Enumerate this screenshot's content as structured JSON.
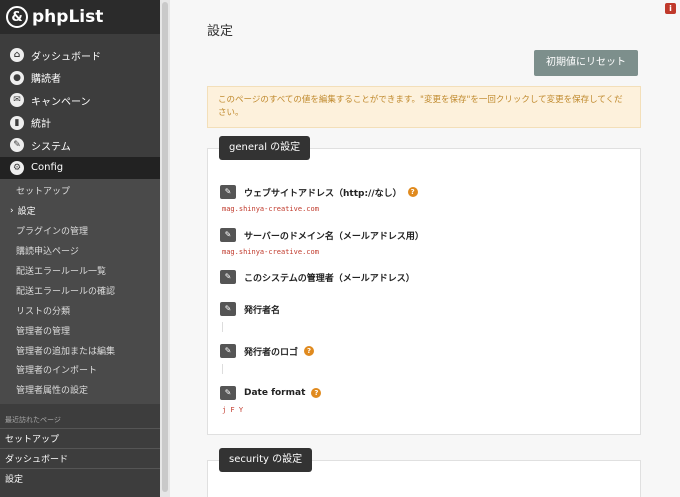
{
  "brand": {
    "name": "phpList",
    "mark": "&"
  },
  "nav": [
    {
      "label": "ダッシュボード",
      "icon": "home-icon",
      "glyph": "⌂"
    },
    {
      "label": "購読者",
      "icon": "user-icon",
      "glyph": "●"
    },
    {
      "label": "キャンペーン",
      "icon": "mail-icon",
      "glyph": "✉"
    },
    {
      "label": "統計",
      "icon": "chart-icon",
      "glyph": "▮"
    },
    {
      "label": "システム",
      "icon": "wrench-icon",
      "glyph": "✎"
    },
    {
      "label": "Config",
      "icon": "gear-icon",
      "glyph": "⚙"
    }
  ],
  "config_submenu": [
    "セットアップ",
    "設定",
    "プラグインの管理",
    "購読申込ページ",
    "配送エラールール一覧",
    "配送エラールールの確認",
    "リストの分類",
    "管理者の管理",
    "管理者の追加または編集",
    "管理者のインポート",
    "管理者属性の設定"
  ],
  "recent": {
    "header": "最近訪れたページ",
    "items": [
      "セットアップ",
      "ダッシュボード",
      "設定"
    ]
  },
  "main": {
    "title": "設定",
    "reset_label": "初期値にリセット",
    "notice": "このページのすべての値を編集することができます。\"変更を保存\"を一回クリックして変更を保存してください。",
    "info_glyph": "i"
  },
  "general": {
    "tab": "general の設定",
    "settings": [
      {
        "label": "ウェブサイトアドレス（http://なし）",
        "help": true,
        "value": "mag.shinya-creative.com"
      },
      {
        "label": "サーバーのドメイン名（メールアドレス用）",
        "help": false,
        "value": "mag.shinya-creative.com"
      },
      {
        "label": "このシステムの管理者（メールアドレス）",
        "help": false,
        "value": ""
      },
      {
        "label": "発行者名",
        "help": false,
        "value": ""
      },
      {
        "label": "発行者のロゴ",
        "help": true,
        "value": ""
      },
      {
        "label": "Date format",
        "help": true,
        "value": "j F Y"
      }
    ]
  },
  "security": {
    "tab": "security の設定"
  },
  "colors": {
    "sidebar": "#3d3d3d",
    "accent": "#c0392b",
    "help": "#e08a1e",
    "reset": "#7d8f8c"
  }
}
